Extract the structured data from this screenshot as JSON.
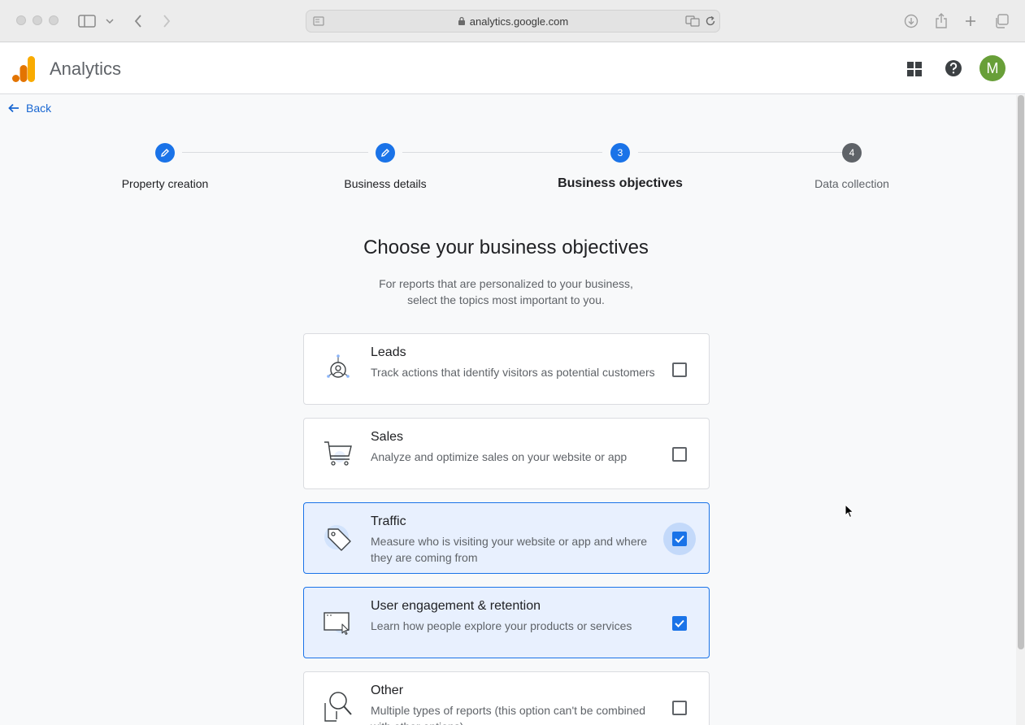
{
  "browser": {
    "url": "analytics.google.com"
  },
  "app": {
    "title": "Analytics",
    "avatar_initial": "M",
    "avatar_color": "#689f38",
    "accent_color": "#1a73e8"
  },
  "nav": {
    "back_label": "Back"
  },
  "stepper": {
    "steps": [
      {
        "number": "1",
        "label": "Property creation",
        "state": "completed",
        "icon": "pencil-icon"
      },
      {
        "number": "2",
        "label": "Business details",
        "state": "completed",
        "icon": "pencil-icon"
      },
      {
        "number": "3",
        "label": "Business objectives",
        "state": "current"
      },
      {
        "number": "4",
        "label": "Data collection",
        "state": "upcoming"
      }
    ]
  },
  "page": {
    "heading": "Choose your business objectives",
    "subheading_line1": "For reports that are personalized to your business,",
    "subheading_line2": "select the topics most important to you."
  },
  "objectives": [
    {
      "title": "Leads",
      "description": "Track actions that identify visitors as potential customers",
      "checked": false,
      "icon": "leads-icon"
    },
    {
      "title": "Sales",
      "description": "Analyze and optimize sales on your website or app",
      "checked": false,
      "icon": "shopping-cart-icon"
    },
    {
      "title": "Traffic",
      "description": "Measure who is visiting your website or app and where they are coming from",
      "checked": true,
      "icon": "tag-icon"
    },
    {
      "title": "User engagement & retention",
      "description": "Learn how people explore your products or services",
      "checked": true,
      "icon": "browser-window-icon"
    },
    {
      "title": "Other",
      "description": "Multiple types of reports (this option can't be combined with other options)",
      "checked": false,
      "icon": "magnifier-icon"
    }
  ]
}
